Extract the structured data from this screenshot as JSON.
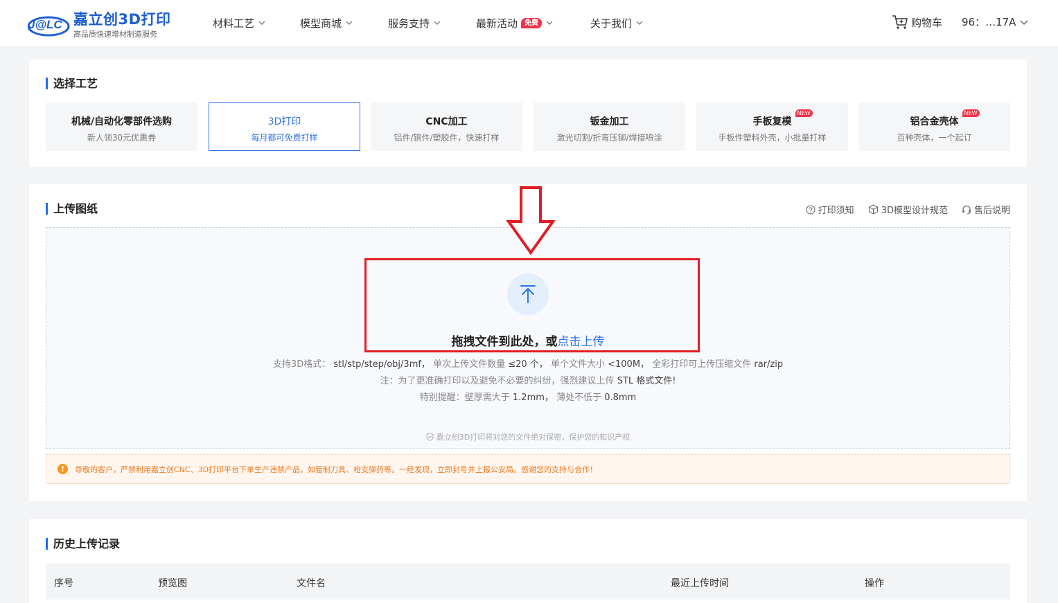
{
  "header": {
    "logo_mark": "J@LC",
    "logo_title": "嘉立创3D打印",
    "logo_subtitle": "高品质快速增材制造服务",
    "nav": [
      {
        "label": "材料工艺"
      },
      {
        "label": "模型商城"
      },
      {
        "label": "服务支持"
      },
      {
        "label": "最新活动",
        "badge": "免费"
      },
      {
        "label": "关于我们"
      }
    ],
    "cart_label": "购物车",
    "user_label": "96：…17A"
  },
  "process": {
    "title": "选择工艺",
    "cards": [
      {
        "name": "机械/自动化零部件选购",
        "desc": "新人领30元优惠券",
        "active": false
      },
      {
        "name": "3D打印",
        "desc": "每月都可免费打样",
        "active": true
      },
      {
        "name": "CNC加工",
        "desc": "铝件/铜件/塑胶件，快速打样",
        "active": false
      },
      {
        "name": "钣金加工",
        "desc": "激光切割/折弯压铆/焊接喷涂",
        "active": false
      },
      {
        "name": "手板复模",
        "desc": "手板件塑料外壳，小批量打样",
        "active": false,
        "badge": "NEW"
      },
      {
        "name": "铝合金壳体",
        "desc": "百种壳体，一个起订",
        "active": false,
        "badge": "NEW"
      }
    ]
  },
  "upload": {
    "title": "上传图纸",
    "links": [
      {
        "label": "打印须知",
        "icon": "question-circle-icon"
      },
      {
        "label": "3D模型设计规范",
        "icon": "cube-icon"
      },
      {
        "label": "售后说明",
        "icon": "headset-icon"
      }
    ],
    "drag_text": "拖拽文件到此处，或",
    "drag_link": "点击上传",
    "formats_label": "支持3D格式：",
    "formats_value": "stl/stp/step/obj/3mf，",
    "count_label": "单次上传文件数量",
    "count_value": "≤20 个，",
    "size_label": "单个文件大小",
    "size_value": "<100M，",
    "color_label": "全彩打印可上传压缩文件",
    "color_value": "rar/zip",
    "note_label": "注：为了更准确打印以及避免不必要的纠纷，强烈建议上传",
    "note_value": "STL 格式文件!",
    "reminder_label": "特别提醒：壁厚需大于",
    "reminder_value1": "1.2mm，",
    "reminder_mid": "薄处不低于",
    "reminder_value2": "0.8mm",
    "secure_text": "嘉立创3D打印将对您的文件绝对保密，保护您的知识产权",
    "warning_text": "尊敬的客户，严禁利用嘉立创CNC、3D打印平台下单生产违禁产品，如管制刀具、枪支弹药等。一经发现，立即封号并上报公安局。感谢您的支持与合作！"
  },
  "history": {
    "title": "历史上传记录",
    "columns": [
      "序号",
      "预览图",
      "文件名",
      "最近上传时间",
      "操作"
    ]
  },
  "colors": {
    "accent": "#2f73e8",
    "annotation": "#e21c24",
    "warning": "#ee7a1f"
  }
}
